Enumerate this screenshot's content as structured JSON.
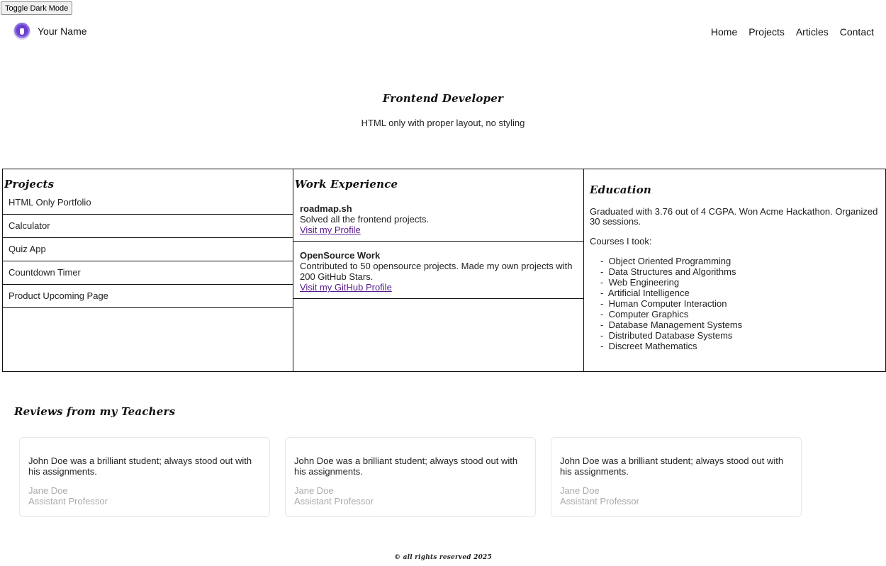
{
  "toggle_label": "Toggle Dark Mode",
  "header": {
    "brand_name": "Your Name",
    "nav": [
      "Home",
      "Projects",
      "Articles",
      "Contact"
    ]
  },
  "hero": {
    "title": "Frontend Developer",
    "subtitle": "HTML only with proper layout, no styling"
  },
  "projects": {
    "heading": "Projects",
    "items": [
      "HTML Only Portfolio",
      "Calculator",
      "Quiz App",
      "Countdown Timer",
      "Product Upcoming Page"
    ]
  },
  "work": {
    "heading": "Work Experience",
    "items": [
      {
        "name": "roadmap.sh",
        "desc": "Solved all the frontend projects.",
        "link": "Visit my Profile"
      },
      {
        "name": "OpenSource Work",
        "desc": "Contributed to 50 opensource projects. Made my own projects with 200 GitHub Stars.",
        "link": "Visit my GitHub Profile"
      }
    ]
  },
  "education": {
    "heading": "Education",
    "summary": "Graduated with 3.76 out of 4 CGPA. Won Acme Hackathon. Organized 30 sessions.",
    "courses_label": "Courses I took:",
    "courses": [
      "Object Oriented Programming",
      "Data Structures and Algorithms",
      "Web Engineering",
      "Artificial Intelligence",
      "Human Computer Interaction",
      "Computer Graphics",
      "Database Management Systems",
      "Distributed Database Systems",
      "Discreet Mathematics"
    ]
  },
  "reviews": {
    "heading": "Reviews from my Teachers",
    "items": [
      {
        "text": "John Doe was a brilliant student; always stood out with his assignments.",
        "author": "Jane Doe",
        "role": "Assistant Professor"
      },
      {
        "text": "John Doe was a brilliant student; always stood out with his assignments.",
        "author": "Jane Doe",
        "role": "Assistant Professor"
      },
      {
        "text": "John Doe was a brilliant student; always stood out with his assignments.",
        "author": "Jane Doe",
        "role": "Assistant Professor"
      }
    ]
  },
  "footer": "© all rights reserved 2025"
}
